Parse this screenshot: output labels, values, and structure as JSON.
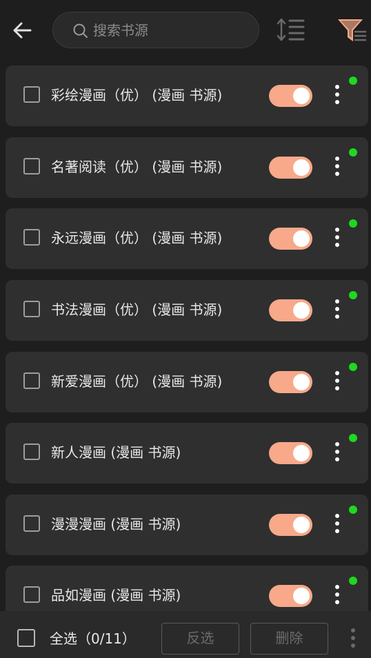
{
  "header": {
    "search_placeholder": "搜索书源",
    "icons": [
      "back-arrow-icon",
      "search-icon",
      "sort-icon",
      "filter-icon"
    ]
  },
  "sources": [
    {
      "name": "彩绘漫画（优） (漫画 书源)",
      "enabled": true
    },
    {
      "name": "名著阅读（优） (漫画 书源)",
      "enabled": true
    },
    {
      "name": "永远漫画（优） (漫画 书源)",
      "enabled": true
    },
    {
      "name": "书法漫画（优） (漫画 书源)",
      "enabled": true
    },
    {
      "name": "新爱漫画（优） (漫画 书源)",
      "enabled": true
    },
    {
      "name": "新人漫画 (漫画 书源)",
      "enabled": true
    },
    {
      "name": "漫漫漫画 (漫画 书源)",
      "enabled": true
    },
    {
      "name": "品如漫画 (漫画 书源)",
      "enabled": true
    }
  ],
  "footer": {
    "select_all_label": "全选（0/11）",
    "invert_label": "反选",
    "delete_label": "删除"
  },
  "colors": {
    "background": "#1e1e1e",
    "card": "#2f2f2f",
    "toggle_on": "#f7a98a",
    "status_dot": "#1fd81f",
    "filter_accent": "#f7a98a"
  }
}
